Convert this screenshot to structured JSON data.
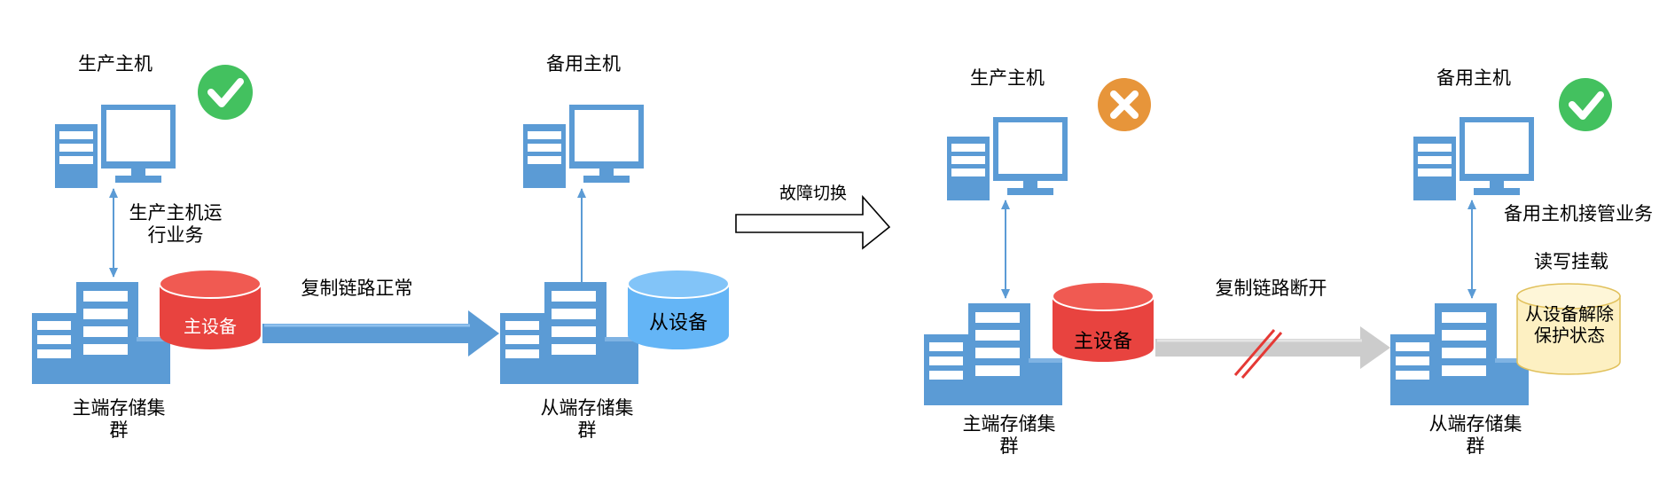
{
  "before": {
    "production_host": "生产主机",
    "backup_host": "备用主机",
    "host_note": "生产主机运行业务",
    "primary_device": "主设备",
    "secondary_device": "从设备",
    "link_status": "复制链路正常",
    "primary_cluster": "主端存储集群",
    "secondary_cluster": "从端存储集群"
  },
  "transition": {
    "label": "故障切换"
  },
  "after": {
    "production_host": "生产主机",
    "backup_host": "备用主机",
    "takeover_note": "备用主机接管业务",
    "rw_mount": "读写挂载",
    "primary_device": "主设备",
    "secondary_device_note": "从设备解除保护状态",
    "link_status": "复制链路断开",
    "primary_cluster": "主端存储集群",
    "secondary_cluster": "从端存储集群"
  },
  "colors": {
    "server": "#5b9bd5",
    "primary_disk": "#e8433f",
    "secondary_disk": "#64b5f6",
    "released_disk": "#fdf0c2",
    "ok": "#43c15f",
    "fail": "#e7953a",
    "broken_link": "#cccccc",
    "cut_mark": "#e53935"
  },
  "icons": {
    "ok": "check-circle-icon",
    "fail": "cross-circle-icon"
  }
}
